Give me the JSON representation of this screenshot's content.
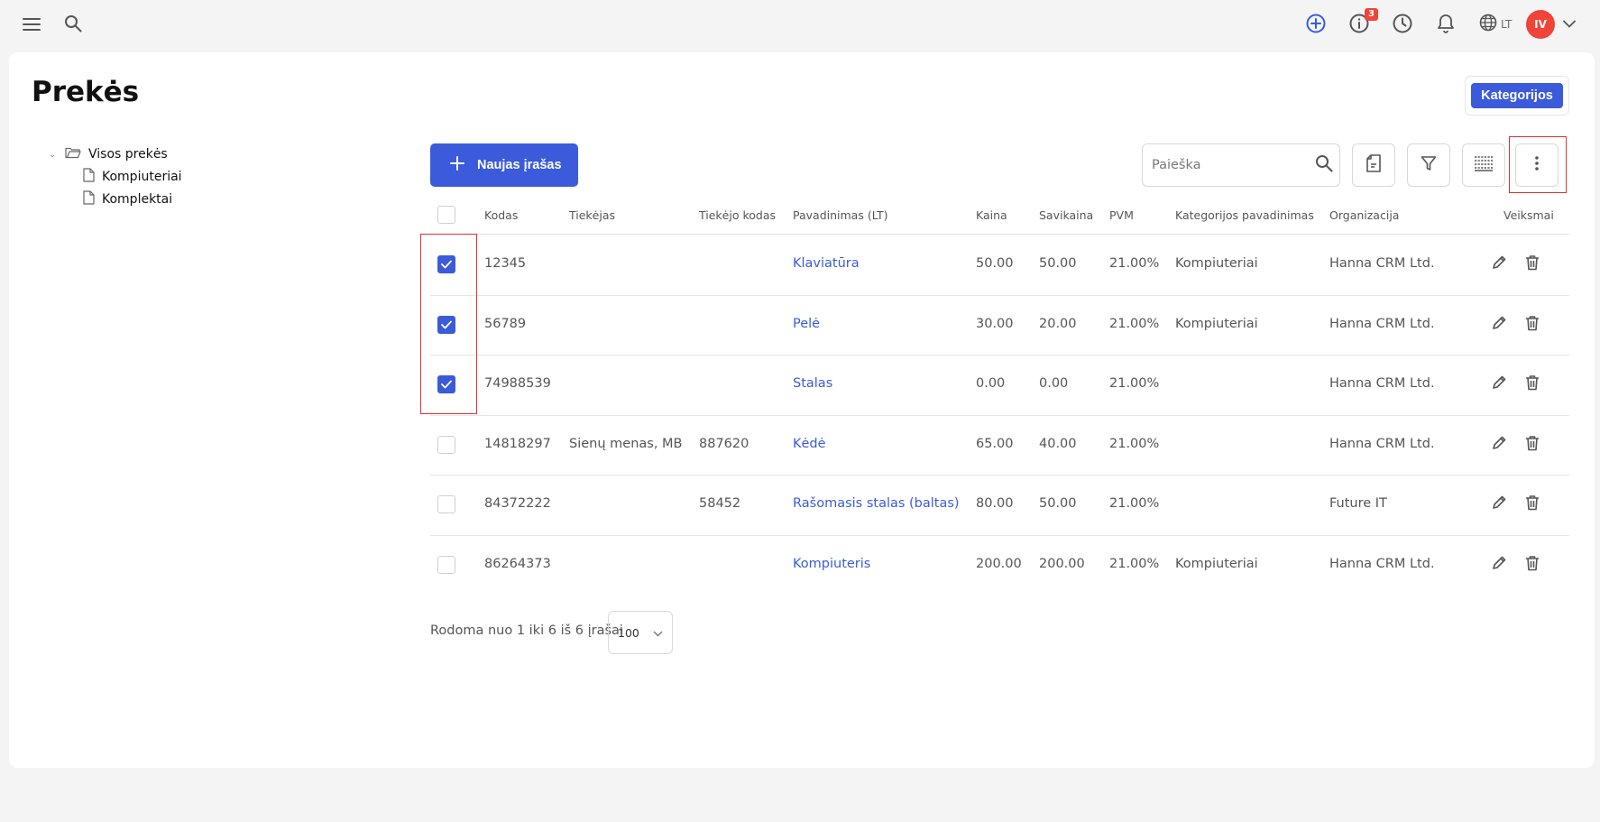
{
  "header": {
    "notifications_badge": "3",
    "language": "LT",
    "avatar_initials": "IV"
  },
  "page": {
    "title": "Prekės",
    "categories_button": "Kategorijos"
  },
  "tree": {
    "root": "Visos prekės",
    "children": [
      "Kompiuteriai",
      "Komplektai"
    ]
  },
  "toolbar": {
    "new_button": "Naujas įrašas",
    "search_placeholder": "Paieška"
  },
  "table": {
    "columns": [
      "Kodas",
      "Tiekėjas",
      "Tiekėjo kodas",
      "Pavadinimas (LT)",
      "Kaina",
      "Savikaina",
      "PVM",
      "Kategorijos pavadinimas",
      "Organizacija",
      "Veiksmai"
    ],
    "rows": [
      {
        "checked": true,
        "code": "12345",
        "supplier": "",
        "supplier_code": "",
        "name": "Klaviatūra",
        "price": "50.00",
        "cost": "50.00",
        "vat": "21.00%",
        "category": "Kompiuteriai",
        "org": "Hanna CRM Ltd."
      },
      {
        "checked": true,
        "code": "56789",
        "supplier": "",
        "supplier_code": "",
        "name": "Pelė",
        "price": "30.00",
        "cost": "20.00",
        "vat": "21.00%",
        "category": "Kompiuteriai",
        "org": "Hanna CRM Ltd."
      },
      {
        "checked": true,
        "code": "74988539",
        "supplier": "",
        "supplier_code": "",
        "name": "Stalas",
        "price": "0.00",
        "cost": "0.00",
        "vat": "21.00%",
        "category": "",
        "org": "Hanna CRM Ltd."
      },
      {
        "checked": false,
        "code": "14818297",
        "supplier": "Sienų menas, MB",
        "supplier_code": "887620",
        "name": "Kėdė",
        "price": "65.00",
        "cost": "40.00",
        "vat": "21.00%",
        "category": "",
        "org": "Hanna CRM Ltd."
      },
      {
        "checked": false,
        "code": "84372222",
        "supplier": "",
        "supplier_code": "58452",
        "name": "Rašomasis stalas (baltas)",
        "price": "80.00",
        "cost": "50.00",
        "vat": "21.00%",
        "category": "",
        "org": "Future IT"
      },
      {
        "checked": false,
        "code": "86264373",
        "supplier": "",
        "supplier_code": "",
        "name": "Kompiuteris",
        "price": "200.00",
        "cost": "200.00",
        "vat": "21.00%",
        "category": "Kompiuteriai",
        "org": "Hanna CRM Ltd."
      }
    ]
  },
  "footer": {
    "summary": "Rodoma nuo 1 iki 6 iš 6 įrašai",
    "page_size": "100"
  },
  "colors": {
    "primary": "#3b5bdb",
    "danger": "#f04438",
    "highlight": "#e03131"
  }
}
